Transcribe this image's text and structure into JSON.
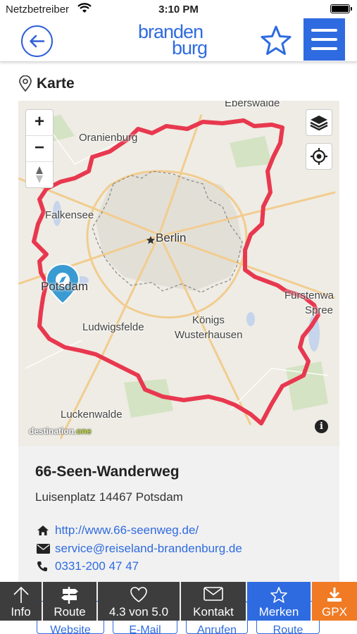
{
  "status": {
    "carrier": "Netzbetreiber",
    "time": "3:10 PM"
  },
  "header": {
    "logo_line1": "branden",
    "logo_line2": "burg",
    "icons": {
      "back": "arrow-left-icon",
      "favorite": "star-icon",
      "menu": "hamburger-icon"
    }
  },
  "section": {
    "title": "Karte",
    "icon": "map-pin-icon"
  },
  "map": {
    "places": [
      "Eberswalde",
      "Oranienburg",
      "Falkensee",
      "Berlin",
      "Potsdam",
      "Ludwigsfelde",
      "Königs",
      "Wusterhausen",
      "Fürstenwa",
      "Spree",
      "Luckenwalde"
    ],
    "zoom_in": "+",
    "zoom_out": "−",
    "attribution_a": "destination.",
    "attribution_b": "one",
    "info": "i",
    "route_color": "#e8384f",
    "marker_color": "#3a9bd2"
  },
  "details": {
    "name": "66-Seen-Wanderweg",
    "address": "Luisenplatz 14467 Potsdam",
    "website": "http://www.66-seenweg.de/",
    "email": "service@reiseland-brandenburg.de",
    "phone": "0331-200 47 47"
  },
  "tabbar": {
    "info": "Info",
    "route": "Route",
    "rating": "4.3 von 5.0",
    "contact": "Kontakt",
    "bookmark": "Merken",
    "gpx": "GPX"
  },
  "hidden_buttons": [
    "Website",
    "E-Mail",
    "Anrufen",
    "Route"
  ]
}
